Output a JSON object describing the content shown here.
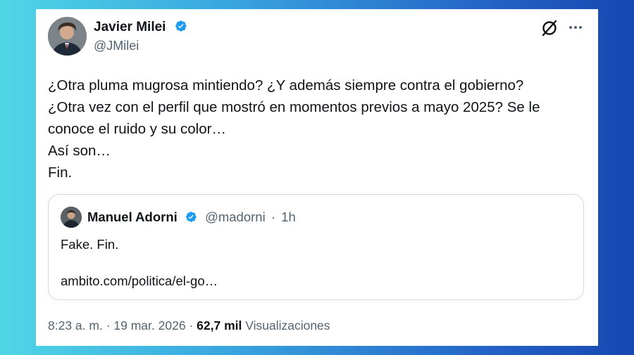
{
  "author": {
    "name": "Javier Milei",
    "handle": "@JMilei",
    "verified": true
  },
  "icons": {
    "verified": "verified-badge-icon",
    "grok": "grok-icon",
    "more": "more-options-icon",
    "verified_color": "#1d9bf0"
  },
  "tweet": {
    "lines": [
      "¿Otra pluma mugrosa mintiendo? ¿Y además siempre contra el gobierno?",
      "¿Otra vez con el perfil que mostró en momentos previos a mayo 2025? Se le",
      "conoce el ruido y su color…",
      "Así son…",
      "Fin."
    ]
  },
  "quoted": {
    "name": "Manuel Adorni",
    "handle": "@madorni",
    "separator": "·",
    "time": "1h",
    "text": "Fake. Fin.",
    "link": "ambito.com/politica/el-go…"
  },
  "footer": {
    "time": "8:23 a. m.",
    "sep1": "·",
    "date": "19 mar. 2026",
    "sep2": "·",
    "views_count": "62,7 mil",
    "views_label": "Visualizaciones"
  }
}
